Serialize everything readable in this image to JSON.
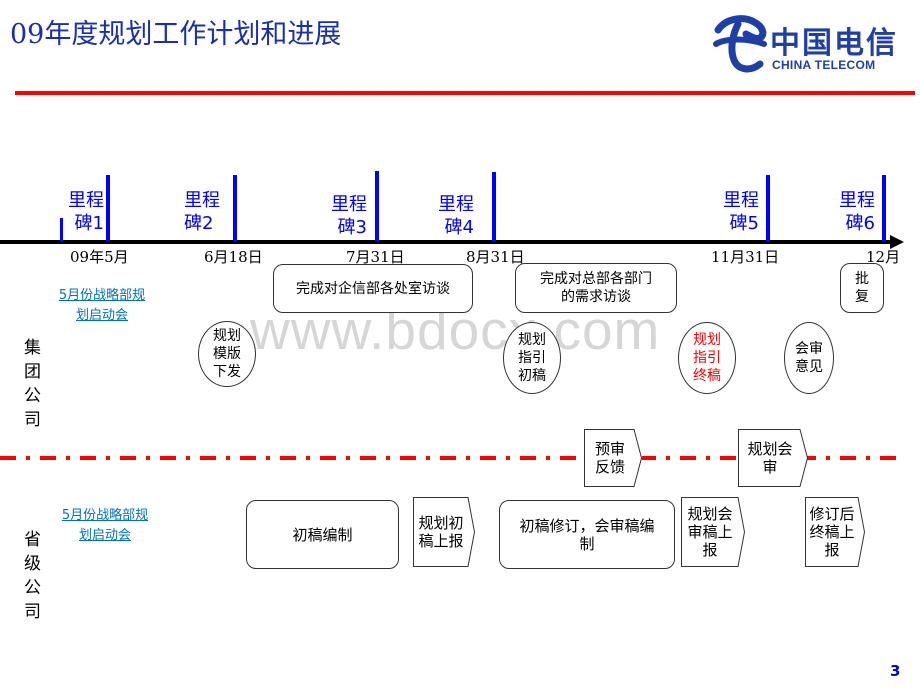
{
  "header": {
    "title": "09年度规划工作计划和进展",
    "logo": {
      "cn": "中国电信",
      "en": "CHINA TELECOM",
      "icon": "china-telecom-e-icon"
    }
  },
  "watermark": "www.bdocx.com",
  "timeline": {
    "milestones": [
      {
        "label_line1": "里程",
        "label_line2": "碑1"
      },
      {
        "label_line1": "里程",
        "label_line2": "碑2"
      },
      {
        "label_line1": "里程",
        "label_line2": "碑3"
      },
      {
        "label_line1": "里程",
        "label_line2": "碑4"
      },
      {
        "label_line1": "里程",
        "label_line2": "碑5"
      },
      {
        "label_line1": "里程",
        "label_line2": "碑6"
      }
    ],
    "dates": [
      "09年5月",
      "6月18日",
      "7月31日",
      "8月31日",
      "11月31日",
      "12月"
    ]
  },
  "group": {
    "label": [
      "集",
      "团",
      "公",
      "司"
    ],
    "kickoff_link": [
      "5月份战略部规",
      "划启动会"
    ],
    "boxes": {
      "interview_enterprise": "完成对企信部各处室访谈",
      "interview_hq": [
        "完成对总部各部门",
        "的需求访谈"
      ],
      "approve": [
        "批",
        "复"
      ]
    },
    "ovals": {
      "template": [
        "规划",
        "模版",
        "下发"
      ],
      "guide_draft": [
        "规划",
        "指引",
        "初稿"
      ],
      "guide_final": [
        "规划",
        "指引",
        "终稿"
      ],
      "review_opinion": [
        "会审",
        "意见"
      ]
    },
    "colors": {
      "final_highlight": "#ff0000"
    }
  },
  "boundary": {
    "pre_review": [
      "预审",
      "反馈"
    ],
    "joint_review": [
      "规划会",
      "审"
    ]
  },
  "province": {
    "label": [
      "省",
      "级",
      "公",
      "司"
    ],
    "kickoff_link": [
      "5月份战略部规",
      "划启动会"
    ],
    "boxes": {
      "draft_compile": "初稿编制",
      "draft_revise": [
        "初稿修订，会审稿编",
        "制"
      ]
    },
    "chevrons": {
      "draft_report": [
        "规划初",
        "稿上报"
      ],
      "review_report": [
        "规划会",
        "审稿上",
        "报"
      ],
      "final_report": [
        "修订后",
        "终稿上",
        "报"
      ]
    }
  },
  "footer": {
    "page_number": "3"
  },
  "colors": {
    "title": "#1a2fb0",
    "rule": "#ff0000",
    "milestone": "#0000ff",
    "link": "#0070c0"
  }
}
